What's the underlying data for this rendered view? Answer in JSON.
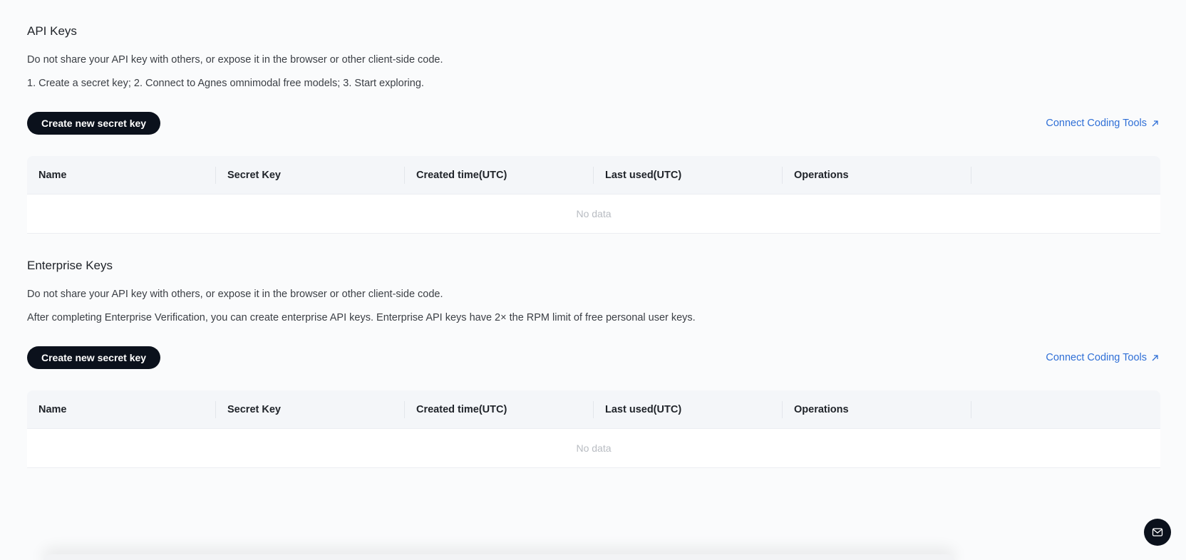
{
  "api_keys": {
    "title": "API Keys",
    "desc_1": "Do not share your API key with others, or expose it in the browser or other client-side code.",
    "desc_2": "1. Create a secret key; 2. Connect to Agnes omnimodal free models; 3. Start exploring.",
    "create_button": "Create new secret key",
    "connect_link": "Connect Coding Tools",
    "table": {
      "columns": [
        "Name",
        "Secret Key",
        "Created time(UTC)",
        "Last used(UTC)",
        "Operations"
      ],
      "empty_text": "No data"
    }
  },
  "enterprise_keys": {
    "title": "Enterprise Keys",
    "desc_1": "Do not share your API key with others, or expose it in the browser or other client-side code.",
    "desc_2": "After completing Enterprise Verification, you can create enterprise API keys. Enterprise API keys have 2× the RPM limit of free personal user keys.",
    "create_button": "Create new secret key",
    "connect_link": "Connect Coding Tools",
    "table": {
      "columns": [
        "Name",
        "Secret Key",
        "Created time(UTC)",
        "Last used(UTC)",
        "Operations"
      ],
      "empty_text": "No data"
    }
  },
  "icons": {
    "external_link": "arrow-up-right-icon",
    "mail": "mail-icon"
  },
  "colors": {
    "primary_button": "#0b111c",
    "link": "#2f6fd6",
    "table_header": "#f4f6f9"
  }
}
